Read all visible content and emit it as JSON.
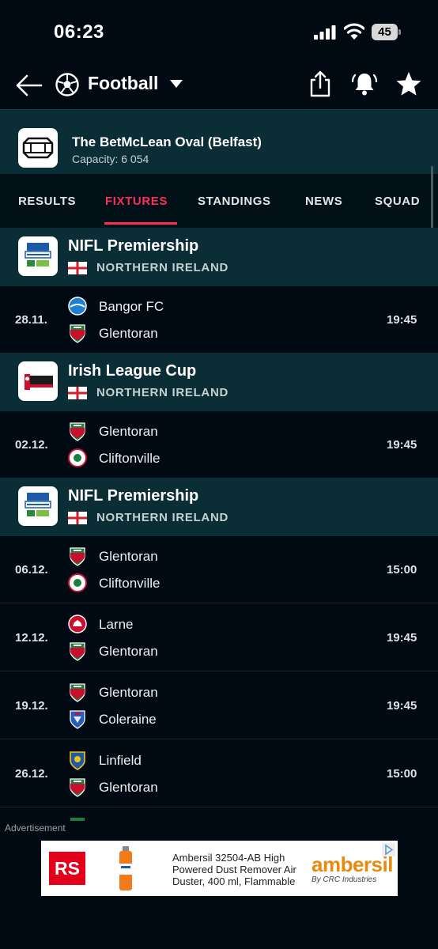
{
  "status_bar": {
    "time": "06:23",
    "battery": "45"
  },
  "app_bar": {
    "title": "Football",
    "icons": [
      "back-arrow-icon",
      "football-icon",
      "caret-down-icon",
      "share-icon",
      "bell-icon",
      "star-icon"
    ]
  },
  "venue": {
    "name": "The BetMcLean Oval (Belfast)",
    "capacity": "Capacity: 6 054"
  },
  "tabs": [
    "RESULTS",
    "FIXTURES",
    "STANDINGS",
    "NEWS",
    "SQUAD"
  ],
  "active_tab": "FIXTURES",
  "sections": [
    {
      "league": "NIFL Premiership",
      "country": "NORTHERN IRELAND",
      "matches": [
        {
          "date": "28.11.",
          "home": "Bangor FC",
          "away": "Glentoran",
          "time": "19:45"
        }
      ]
    },
    {
      "league": "Irish League Cup",
      "country": "NORTHERN IRELAND",
      "matches": [
        {
          "date": "02.12.",
          "home": "Glentoran",
          "away": "Cliftonville",
          "time": "19:45"
        }
      ]
    },
    {
      "league": "NIFL Premiership",
      "country": "NORTHERN IRELAND",
      "matches": [
        {
          "date": "06.12.",
          "home": "Glentoran",
          "away": "Cliftonville",
          "time": "15:00"
        },
        {
          "date": "12.12.",
          "home": "Larne",
          "away": "Glentoran",
          "time": "19:45"
        },
        {
          "date": "19.12.",
          "home": "Glentoran",
          "away": "Coleraine",
          "time": "19:45"
        },
        {
          "date": "26.12.",
          "home": "Linfield",
          "away": "Glentoran",
          "time": "15:00"
        }
      ]
    }
  ],
  "ad": {
    "label": "Advertisement",
    "logo": "RS",
    "text": "Ambersil 32504-AB High Powered Dust Remover Air Duster, 400 ml, Flammable",
    "brand": "ambersil",
    "brand_sub": "By CRC Industries"
  },
  "colors": {
    "accent": "#ff2d57",
    "background": "#010a13",
    "section": "#0b2e36"
  }
}
